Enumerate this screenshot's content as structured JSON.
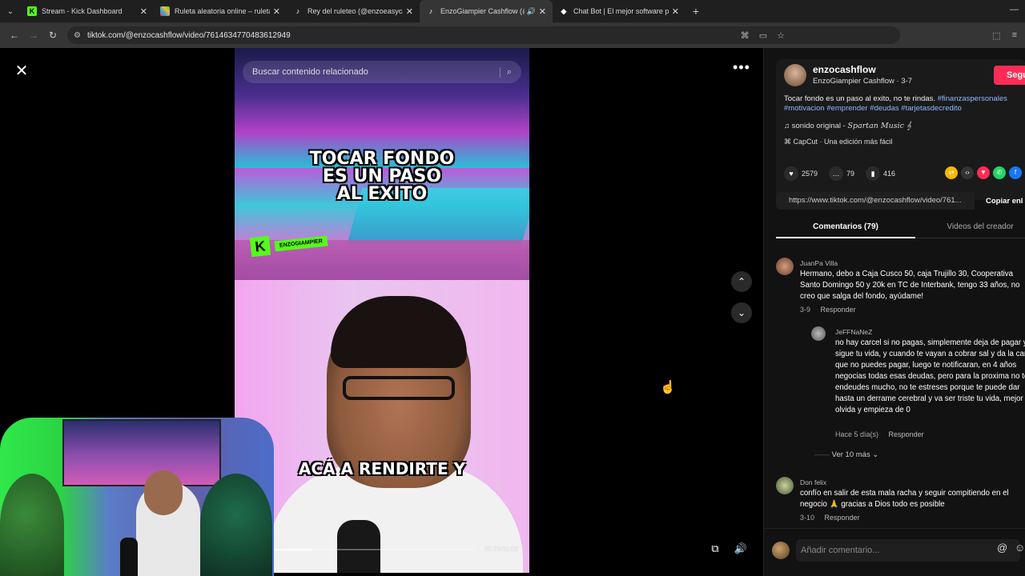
{
  "browser": {
    "tabs": [
      {
        "label": "Stream - Kick Dashboard",
        "color": "#53fc18",
        "icon": "K"
      },
      {
        "label": "Ruleta aleatoria online – ruleta",
        "color": "#e04040",
        "icon": "■"
      },
      {
        "label": "Rey del ruleteo (@enzoeasyca",
        "color": "#111111",
        "icon": "♪"
      },
      {
        "label": "EnzoGiampier Cashflow (@",
        "color": "#111111",
        "icon": "♪"
      },
      {
        "label": "Chat Bot | El mejor software pa",
        "color": "#ffffff",
        "icon": "◆"
      }
    ],
    "url": "tiktok.com/@enzocashflow/video/7614634770483612949"
  },
  "video": {
    "search_placeholder": "Buscar contenido relacionado",
    "caption_top": "TOCAR FONDO\nES UN PASO\nAL EXITO",
    "caption_bottom": "ACÁ A RENDIRTE Y",
    "logo_tag": "ENZOGIAMPIER",
    "time": "00:23/01:02",
    "progress": 0.22
  },
  "panel": {
    "username": "enzocashflow",
    "nickname": "EnzoGiampier Cashflow · 3-7",
    "follow_label": "Segu",
    "description": "Tocar fondo es un paso al exito, no te rindas.",
    "hashtags": "#finanzaspersonales #motivacion #emprender #deudas #tarjetasdecredito",
    "sound_label": "sonido original - ",
    "sound_artist": "Spartan Music 𝄞",
    "capcut": "CapCut · Una edición más fácil",
    "likes": "2579",
    "comments_count": "79",
    "saves": "416",
    "link": "https://www.tiktok.com/@enzocashflow/video/761...",
    "copy_label": "Copiar enl",
    "tab_comments": "Comentarios (79)",
    "tab_creator": "Videos del creador",
    "comments": [
      {
        "user": "JuanPa Villa",
        "text": "Hermano, debo a Caja Cusco 50, caja Trujillo 30, Cooperativa Santo Domingo 50 y 20k en TC de Interbank, tengo 33 años, no creo que salga del fondo, ayúdame!",
        "date": "3-9",
        "reply": "Responder"
      },
      {
        "user": "JeFFNaNeZ",
        "text": "no hay carcel si no pagas, simplemente deja de pagar y sigue tu vida, y cuando te vayan a cobrar sal y da la cara que no puedes pagar, luego te notificaran, en 4 años negocias todas esas deudas, pero para la proxima no te endeudes mucho, no te estreses porque te puede dar hasta un derrame cerebral y va ser triste tu vida, mejor ya olvida y empieza de 0",
        "date": "Hace 5 día(s)",
        "reply": "Responder"
      },
      {
        "user": "Don felix",
        "text": "confío en salir de esta mala racha y seguir compitiendo en el negocio 🙏 gracias a Dios todo es posible",
        "date": "3-10",
        "reply": "Responder"
      }
    ],
    "view_more": "Ver 10 más",
    "compose_placeholder": "Añadir comentario..."
  }
}
